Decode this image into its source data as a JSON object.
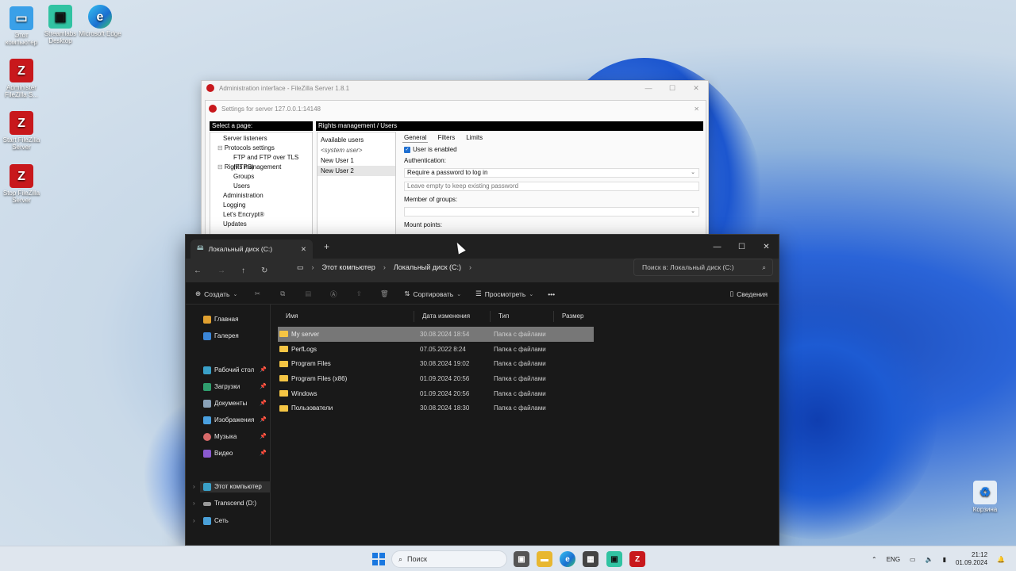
{
  "desktop": {
    "icons": [
      {
        "label": "Этот компьютер"
      },
      {
        "label": "Streamlabs Desktop"
      },
      {
        "label": "Microsoft Edge"
      },
      {
        "label": "Administer FileZilla S..."
      },
      {
        "label": "Start FileZilla Server"
      },
      {
        "label": "Stop FileZilla Server"
      },
      {
        "label": "Корзина"
      }
    ]
  },
  "filezilla": {
    "window_title": "Administration interface - FileZilla Server 1.8.1",
    "dialog_title": "Settings for server 127.0.0.1:14148",
    "select_page_header": "Select a page:",
    "section_header": "Rights management / Users",
    "pages": [
      "Server listeners",
      "Protocols settings",
      "FTP and FTP over TLS (FTPS)",
      "Rights management",
      "Groups",
      "Users",
      "Administration",
      "Logging",
      "Let's Encrypt®",
      "Updates"
    ],
    "users_header": "Available users",
    "users": [
      "<system user>",
      "New User 1",
      "New User 2"
    ],
    "tabs": [
      "General",
      "Filters",
      "Limits"
    ],
    "user_enabled_label": "User is enabled",
    "authentication_label": "Authentication:",
    "authentication_value": "Require a password to log in",
    "password_placeholder": "Leave empty to keep existing password",
    "member_of_groups_label": "Member of groups:",
    "mount_points_label": "Mount points:"
  },
  "explorer": {
    "tab_title": "Локальный диск (C:)",
    "breadcrumb": [
      "Этот компьютер",
      "Локальный диск (C:)"
    ],
    "search_placeholder": "Поиск в: Локальный диск (C:)",
    "toolbar": {
      "create": "Создать",
      "sort": "Сортировать",
      "view": "Просмотреть",
      "details": "Сведения"
    },
    "sidebar": {
      "quick": [
        "Главная",
        "Галерея"
      ],
      "pinned": [
        "Рабочий стол",
        "Загрузки",
        "Документы",
        "Изображения",
        "Музыка",
        "Видео"
      ],
      "drives": [
        "Этот компьютер",
        "Transcend (D:)",
        "Сеть"
      ]
    },
    "columns": [
      "Имя",
      "Дата изменения",
      "Тип",
      "Размер"
    ],
    "files": [
      {
        "name": "My server",
        "date": "30.08.2024 18:54",
        "type": "Папка с файлами"
      },
      {
        "name": "PerfLogs",
        "date": "07.05.2022 8:24",
        "type": "Папка с файлами"
      },
      {
        "name": "Program Files",
        "date": "30.08.2024 19:02",
        "type": "Папка с файлами"
      },
      {
        "name": "Program Files (x86)",
        "date": "01.09.2024 20:56",
        "type": "Папка с файлами"
      },
      {
        "name": "Windows",
        "date": "01.09.2024 20:56",
        "type": "Папка с файлами"
      },
      {
        "name": "Пользователи",
        "date": "30.08.2024 18:30",
        "type": "Папка с файлами"
      }
    ]
  },
  "taskbar": {
    "search_label": "Поиск",
    "language": "ENG",
    "time": "21:12",
    "date": "01.09.2024"
  },
  "colors": {
    "folder": "#f5c544",
    "filezilla_red": "#c8181c",
    "accent": "#1a78e0"
  }
}
